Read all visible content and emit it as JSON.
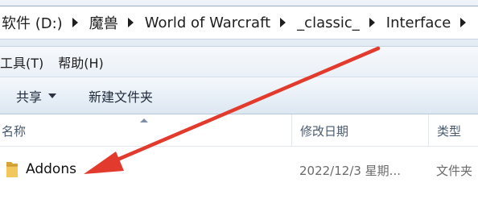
{
  "breadcrumb": [
    {
      "label": "软件 (D:)"
    },
    {
      "label": "魔兽"
    },
    {
      "label": "World of Warcraft"
    },
    {
      "label": "_classic_"
    },
    {
      "label": "Interface"
    }
  ],
  "menu": {
    "tools": "工具(T)",
    "help": "帮助(H)"
  },
  "toolbar": {
    "share": "共享",
    "new_folder": "新建文件夹"
  },
  "columns": {
    "name": "名称",
    "date_modified": "修改日期",
    "type": "类型"
  },
  "files": [
    {
      "name": "Addons",
      "date_modified": "2022/12/3 星期...",
      "type": "文件夹",
      "icon": "folder-icon"
    }
  ],
  "colors": {
    "annotation_arrow": "#e23b2e",
    "folder": "#e7b84a"
  }
}
